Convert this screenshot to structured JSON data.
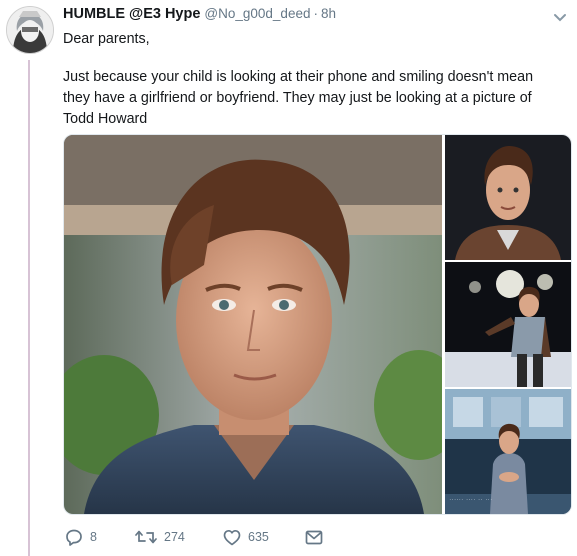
{
  "tweet": {
    "display_name": "HUMBLE @E3 Hype",
    "handle": "@No_g00d_deed",
    "separator": "·",
    "time": "8h",
    "text_line1": "Dear parents,",
    "text_body": "Just because your child is looking at their phone and smiling doesn't mean they have a girlfriend or boyfriend. They may just be looking at a picture of Todd Howard",
    "avatar_icon": "avatar-image",
    "menu_icon": "chevron-down-icon"
  },
  "actions": {
    "reply_count": "8",
    "retweet_count": "274",
    "like_count": "635",
    "reply_icon": "reply-icon",
    "retweet_icon": "retweet-icon",
    "like_icon": "heart-icon",
    "dm_icon": "envelope-icon"
  },
  "media": {
    "photos": [
      "main-photo",
      "photo-top-right",
      "photo-middle-right",
      "photo-bottom-right"
    ]
  },
  "colors": {
    "thread_line": "#d7c3d5",
    "secondary_text": "#657786",
    "primary_text": "#14171a"
  }
}
